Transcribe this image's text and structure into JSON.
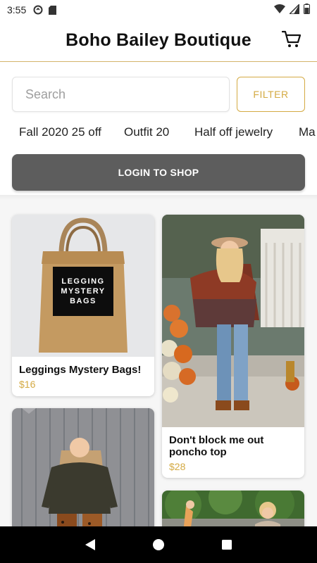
{
  "status_bar": {
    "time": "3:55"
  },
  "header": {
    "title": "Boho Bailey Boutique"
  },
  "search": {
    "placeholder": "Search",
    "value": ""
  },
  "filter": {
    "label": "FILTER"
  },
  "categories": [
    "Fall 2020 25 off",
    "Outfit 20",
    "Half off jewelry",
    "Ma"
  ],
  "login": {
    "label": "LOGIN TO SHOP"
  },
  "products": [
    {
      "name": "Leggings Mystery Bags!",
      "price": "$16",
      "bag_text": "LEGGING MYSTERY BAGS"
    },
    {
      "name": "Don't block me out poncho top",
      "price": "$28"
    }
  ],
  "colors": {
    "accent": "#d4aa43",
    "login_bg": "#5d5d5d",
    "header_rule": "#d4b46a"
  }
}
